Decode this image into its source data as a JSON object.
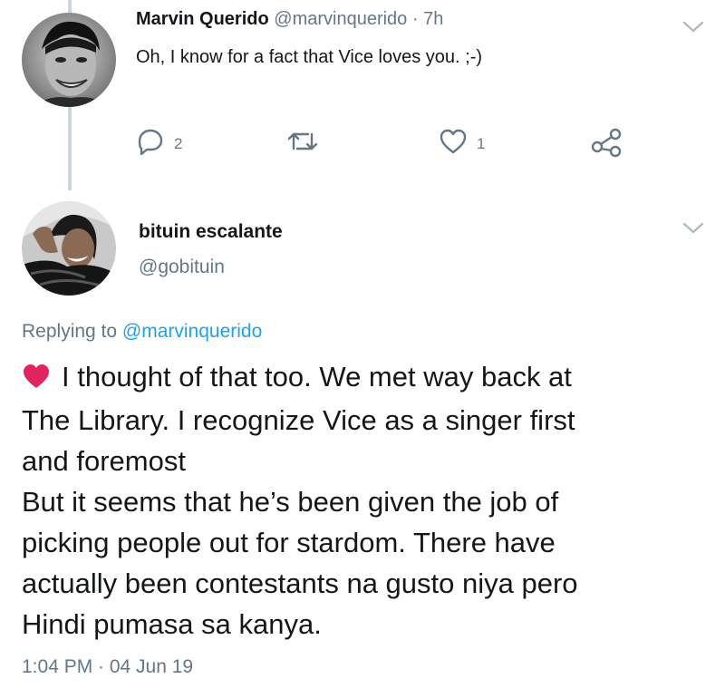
{
  "colors": {
    "text": "#14171a",
    "secondary": "#657786",
    "link": "#1da1f2",
    "thread_line": "#ccd6dd",
    "heart": "#e0245e"
  },
  "tweet1": {
    "name": "Marvin Querido",
    "handle": "@marvinquerido",
    "dot": "·",
    "time": "7h",
    "text": "Oh, I know for a fact that Vice loves you. ;-)",
    "actions": {
      "reply_icon": "reply-icon",
      "reply_count": "2",
      "retweet_icon": "retweet-icon",
      "like_icon": "heart-outline-icon",
      "like_count": "1",
      "share_icon": "share-icon"
    },
    "menu_icon": "chevron-down-icon"
  },
  "tweet2": {
    "name": "bituin escalante",
    "handle": "@gobituin",
    "menu_icon": "chevron-down-icon",
    "replying_prefix": "Replying to",
    "replying_handle": "@marvinquerido",
    "emoji": "heart-emoji",
    "lines": [
      "I thought of that too. We met way back at",
      "The Library. I recognize Vice as a singer first",
      "and foremost",
      "But it seems that he’s been given the job of",
      "picking people out for stardom. There have",
      "actually been contestants na gusto niya pero",
      "Hindi pumasa sa kanya."
    ],
    "timestamp": "1:04 PM · 04 Jun 19"
  }
}
